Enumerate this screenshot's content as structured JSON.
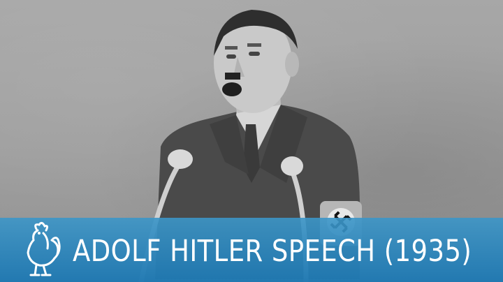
{
  "banner": {
    "title": "ADOLF HITLER SPEECH (1935)",
    "background_color": "#2a80b8",
    "text_color": "#ffffff",
    "logo_icon": "rooster-icon"
  },
  "scene": {
    "tone": "black-and-white",
    "armband_symbol": "swastika-icon"
  }
}
